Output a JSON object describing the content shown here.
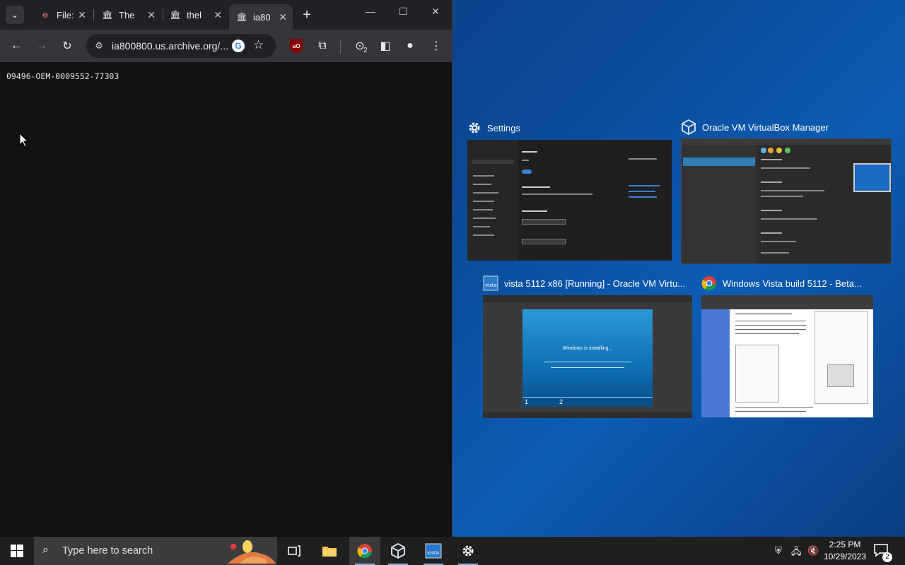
{
  "browser": {
    "tabs": [
      {
        "label": "File:",
        "icon": "wiki-file-icon"
      },
      {
        "label": "The",
        "icon": "archive-icon"
      },
      {
        "label": "thel",
        "icon": "archive-icon"
      },
      {
        "label": "ia80",
        "icon": "archive-icon",
        "active": true
      }
    ],
    "address": "ia800800.us.archive.org/...",
    "download_count": "2",
    "page_text": "09496-OEM-0009552-77303"
  },
  "snap_assist": {
    "settings": {
      "title": "Settings"
    },
    "vbox_manager": {
      "title": "Oracle VM VirtualBox Manager"
    },
    "vista_vm": {
      "title": "vista 5112 x86 [Running] - Oracle VM Virtu...",
      "installing": "Windows is installing...",
      "step1": "1",
      "step2": "2"
    },
    "chrome_wiki": {
      "title": "Windows Vista build 5112 - Beta..."
    }
  },
  "taskbar": {
    "search_placeholder": "Type here to search",
    "time": "2:25 PM",
    "date": "10/29/2023",
    "notification_count": "2"
  },
  "colors": {
    "taskbar_accent": "#76b9ed",
    "desktop": "#0a4a96",
    "chrome_dark": "#35363a"
  }
}
